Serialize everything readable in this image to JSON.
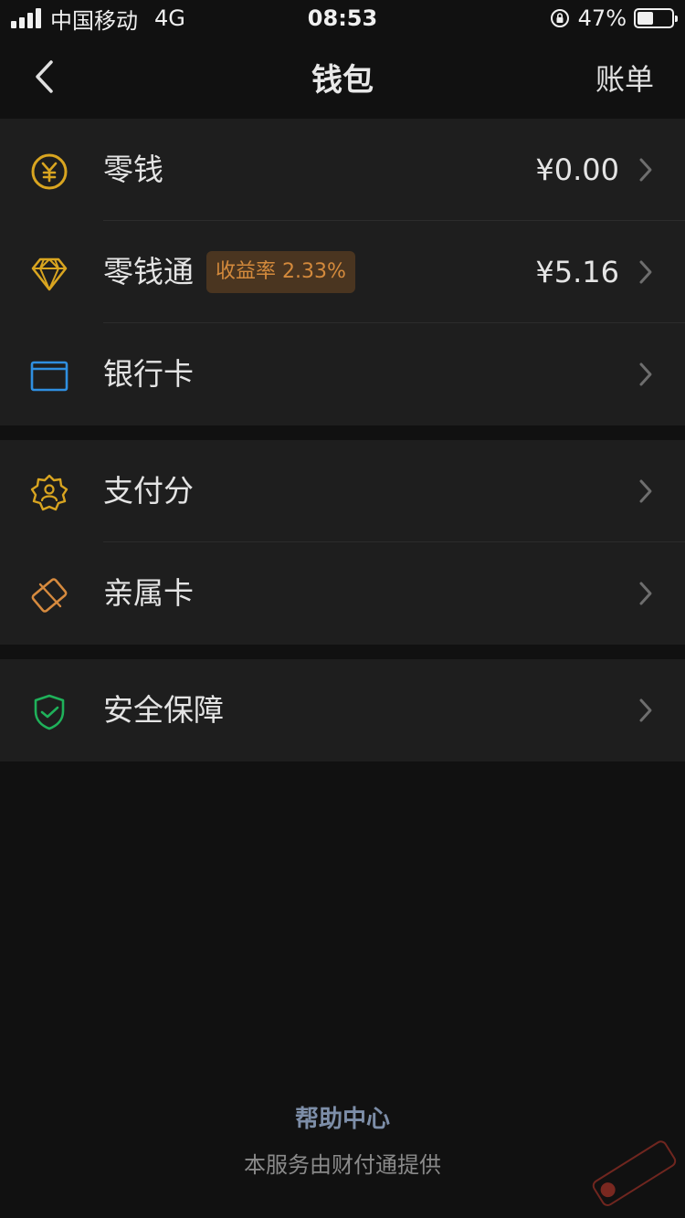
{
  "status_bar": {
    "carrier": "中国移动",
    "network": "4G",
    "time": "08:53",
    "battery_percent_text": "47%",
    "battery_level": 0.47
  },
  "nav": {
    "title": "钱包",
    "action": "账单"
  },
  "groups": [
    {
      "items": [
        {
          "label": "零钱",
          "value": "¥0.00",
          "icon": "yuan-coin-icon"
        },
        {
          "label": "零钱通",
          "badge": "收益率 2.33%",
          "value": "¥5.16",
          "icon": "diamond-icon"
        },
        {
          "label": "银行卡",
          "icon": "bank-card-icon"
        }
      ]
    },
    {
      "items": [
        {
          "label": "支付分",
          "icon": "pay-score-badge-icon"
        },
        {
          "label": "亲属卡",
          "icon": "family-card-icon"
        }
      ]
    },
    {
      "items": [
        {
          "label": "安全保障",
          "icon": "security-shield-icon"
        }
      ]
    }
  ],
  "footer": {
    "help_center": "帮助中心",
    "provider": "本服务由财付通提供"
  },
  "colors": {
    "background": "#111111",
    "card": "#1e1e1e",
    "gold": "#d9a520",
    "blue": "#2f8fe0",
    "orange": "#d68a3e",
    "green": "#1fb15a",
    "link": "#7d8ea8"
  }
}
